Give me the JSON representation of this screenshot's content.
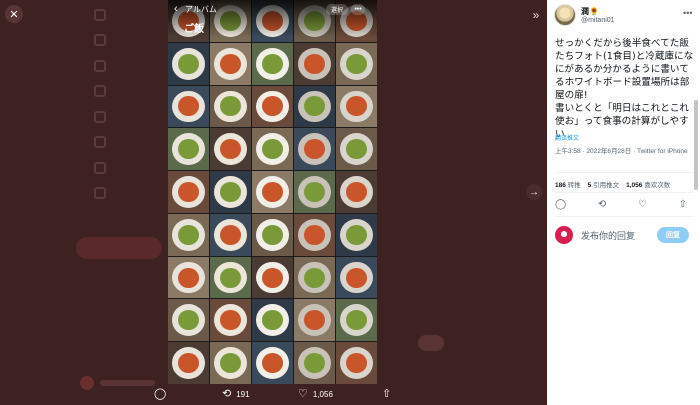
{
  "viewer": {
    "close_glyph": "✕",
    "next_glyph": "→",
    "collapse_glyph": "»"
  },
  "photo": {
    "back_glyph": "‹",
    "album_label": "アルバム",
    "title": "ご飯",
    "select_label": "選択",
    "more_glyph": "•••"
  },
  "actionbar": {
    "reply_glyph": "◯",
    "retweet_glyph": "⟲",
    "retweet_count": "191",
    "like_glyph": "♡",
    "like_count": "1,056",
    "share_glyph": "⇧"
  },
  "tweet": {
    "author_name": "潤🌻",
    "author_handle": "@mitani01",
    "more_glyph": "•••",
    "text": "せっかくだから後半食べてた飯たちフォト(1食目)と冷蔵庫になにがあるか分かるように書いてるホワイトボード設置場所は部屋の扉!\n書いとくと「明日はこれとこれ使お」って食事の計算がしやすい",
    "translate_label": "翻译推文",
    "timestamp": "上午3:58 · 2022年6月28日 · Twitter for iPhone",
    "retweets": "186",
    "retweets_label": "转推",
    "quotes": "5",
    "quotes_label": "引用推文",
    "likes": "1,056",
    "likes_label": "喜欢次数",
    "action_reply": "◯",
    "action_retweet": "⟲",
    "action_like": "♡",
    "action_share": "⇧",
    "reply_placeholder": "发布你的回复",
    "reply_button": "回复"
  },
  "colors": {
    "accent": "#1d9bf0",
    "reply_button_disabled": "#8ecdf8",
    "backdrop": "#3e2222"
  }
}
